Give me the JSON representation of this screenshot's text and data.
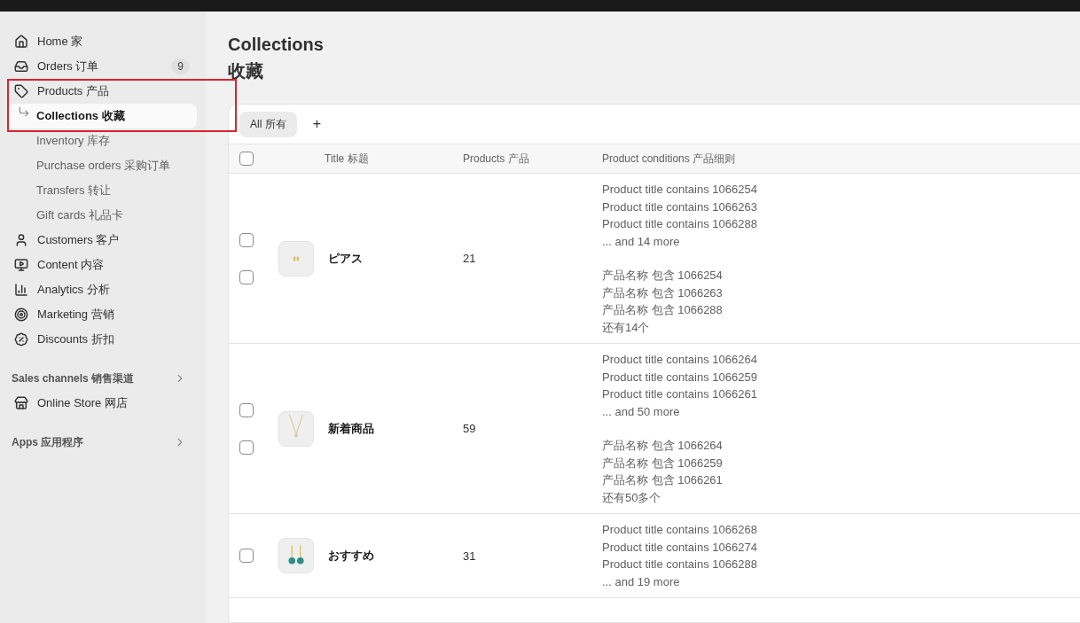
{
  "sidebar": {
    "items": [
      {
        "label": "Home 家",
        "selected": false
      },
      {
        "label": "Orders 订单",
        "selected": false,
        "badge": "9"
      },
      {
        "label": "Products 产品",
        "selected": false,
        "annotated": true,
        "children": [
          {
            "label": "Collections 收藏",
            "selected": true
          },
          {
            "label": "Inventory 库存",
            "selected": false
          },
          {
            "label": "Purchase orders 采购订单",
            "selected": false
          },
          {
            "label": "Transfers 转让",
            "selected": false
          },
          {
            "label": "Gift cards 礼品卡",
            "selected": false
          }
        ]
      },
      {
        "label": "Customers 客户",
        "selected": false
      },
      {
        "label": "Content 内容",
        "selected": false
      },
      {
        "label": "Analytics 分析",
        "selected": false
      },
      {
        "label": "Marketing 营销",
        "selected": false
      },
      {
        "label": "Discounts 折扣",
        "selected": false
      }
    ],
    "sections": [
      {
        "title": "Sales channels 销售渠道",
        "items": [
          {
            "label": "Online Store 网店",
            "selected": false
          }
        ]
      },
      {
        "title": "Apps 应用程序"
      }
    ]
  },
  "page": {
    "title": "Collections",
    "subtitle": "收藏"
  },
  "tabs": [
    {
      "label": "All 所有",
      "selected": true
    }
  ],
  "add_tab": "+",
  "table": {
    "all_checked": false,
    "columns": [
      "Title 标题",
      "Products 产品",
      "Product conditions 产品细则"
    ],
    "rows": [
      {
        "checked": false,
        "checked_2": false,
        "title": "ピアス",
        "count": "21",
        "conditions_en": [
          "Product title contains 1066254",
          "Product title contains 1066263",
          "Product title contains 1066288",
          "... and 14 more"
        ],
        "conditions_zh": [
          "产品名称 包含 1066254",
          "产品名称 包含 1066263",
          "产品名称 包含 1066288",
          "还有14个"
        ]
      },
      {
        "checked": false,
        "checked_2": false,
        "title": "新着商品",
        "count": "59",
        "conditions_en": [
          "Product title contains 1066264",
          "Product title contains 1066259",
          "Product title contains 1066261",
          "... and 50 more"
        ],
        "conditions_zh": [
          "产品名称 包含 1066264",
          "产品名称 包含 1066259",
          "产品名称 包含 1066261",
          "还有50多个"
        ]
      },
      {
        "checked": false,
        "title": "おすすめ",
        "count": "31",
        "conditions_en": [
          "Product title contains 1066268",
          "Product title contains 1066274",
          "Product title contains 1066288",
          "... and 19 more"
        ]
      }
    ]
  }
}
